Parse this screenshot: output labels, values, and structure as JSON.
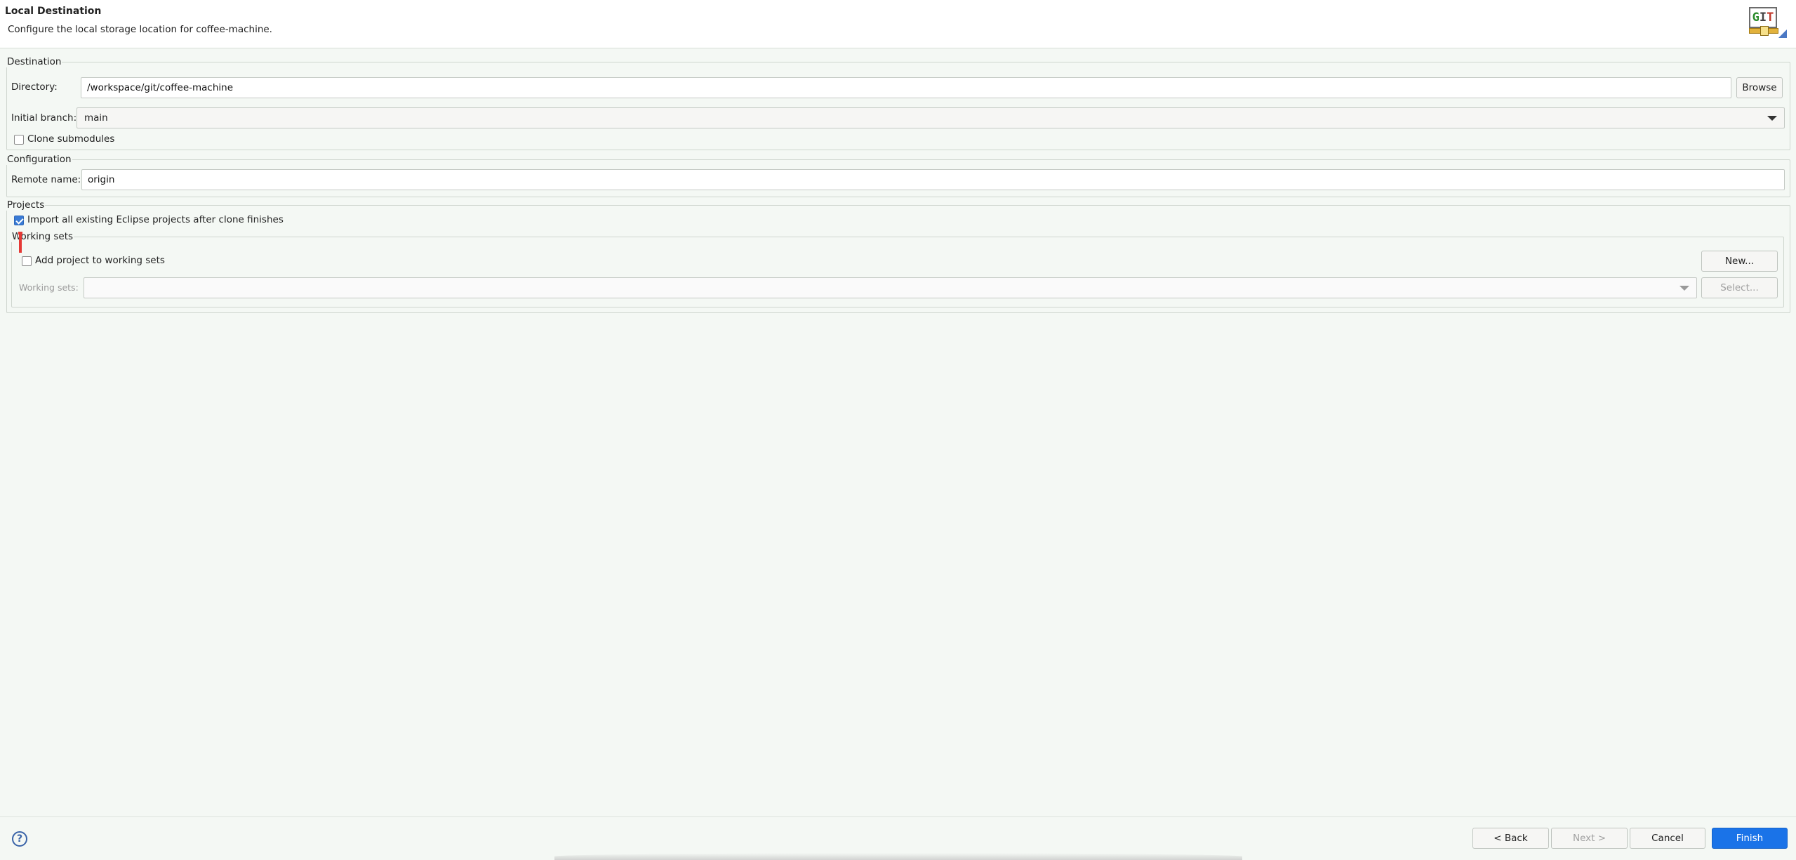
{
  "banner": {
    "title": "Local Destination",
    "description": "Configure the local storage location for coffee-machine.",
    "logo_text": "GIT"
  },
  "destination": {
    "legend": "Destination",
    "directory_label": "Directory:",
    "directory_value": "/workspace/git/coffee-machine",
    "browse_label": "Browse",
    "initial_branch_label": "Initial branch:",
    "initial_branch_value": "main",
    "clone_submodules_label": "Clone submodules",
    "clone_submodules_checked": false
  },
  "configuration": {
    "legend": "Configuration",
    "remote_name_label": "Remote name:",
    "remote_name_value": "origin"
  },
  "projects": {
    "legend": "Projects",
    "import_label": "Import all existing Eclipse projects after clone finishes",
    "import_checked": true,
    "working_sets": {
      "legend": "Working sets",
      "add_label": "Add project to working sets",
      "add_checked": false,
      "new_label": "New...",
      "working_sets_label": "Working sets:",
      "working_sets_value": "",
      "select_label": "Select..."
    }
  },
  "footer": {
    "help_glyph": "?",
    "back_label": "< Back",
    "next_label": "Next >",
    "cancel_label": "Cancel",
    "finish_label": "Finish"
  },
  "colors": {
    "accent": "#1a73e8",
    "background": "#f4f8f4",
    "checkbox_checked": "#3a7bd5",
    "marker": "#e53935"
  }
}
